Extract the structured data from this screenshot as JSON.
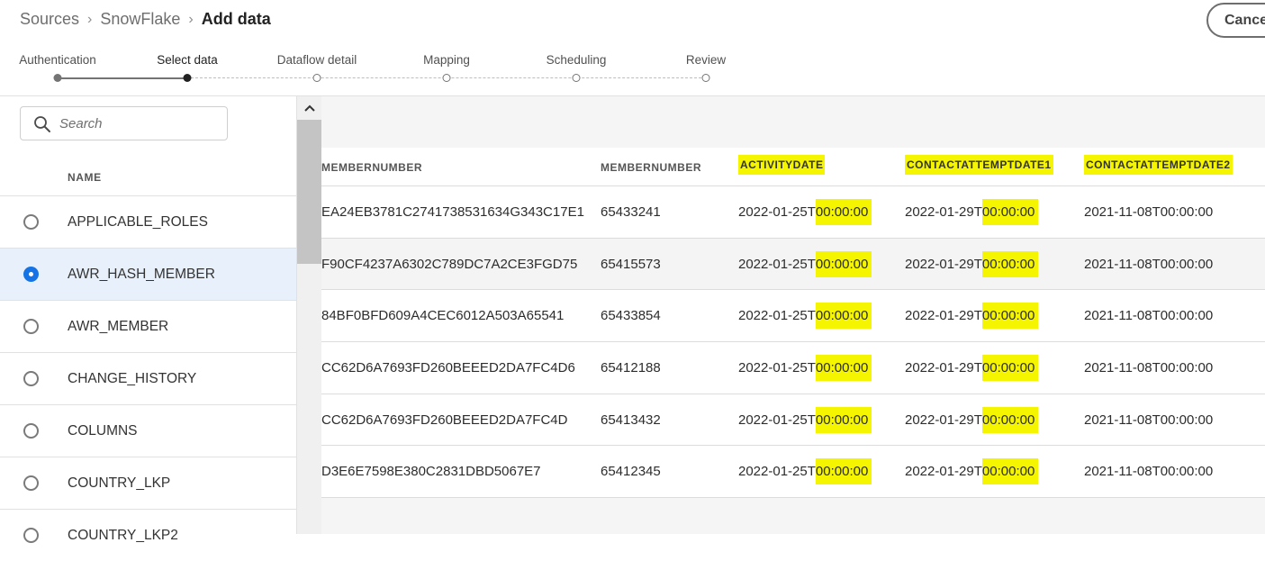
{
  "breadcrumb": {
    "items": [
      "Sources",
      "SnowFlake"
    ],
    "current": "Add data"
  },
  "header": {
    "cancel_label": "Cancel"
  },
  "steps": [
    {
      "label": "Authentication",
      "state": "done"
    },
    {
      "label": "Select data",
      "state": "current"
    },
    {
      "label": "Dataflow detail",
      "state": "todo"
    },
    {
      "label": "Mapping",
      "state": "todo"
    },
    {
      "label": "Scheduling",
      "state": "todo"
    },
    {
      "label": "Review",
      "state": "todo"
    }
  ],
  "search": {
    "placeholder": "Search",
    "value": ""
  },
  "list": {
    "header": "NAME",
    "selected_index": 1,
    "items": [
      "APPLICABLE_ROLES",
      "AWR_HASH_MEMBER",
      "AWR_MEMBER",
      "CHANGE_HISTORY",
      "COLUMNS",
      "COUNTRY_LKP",
      "COUNTRY_LKP2"
    ]
  },
  "table": {
    "columns": [
      "MEMBERNUMBER",
      "MEMBERNUMBER",
      "ACTIVITYDATE",
      "CONTACTATTEMPTDATE1",
      "CONTACTATTEMPTDATE2"
    ],
    "highlighted_columns": [
      "ACTIVITYDATE",
      "CONTACTATTEMPTDATE1",
      "CONTACTATTEMPTDATE2"
    ],
    "rows": [
      {
        "hash": "EA24EB3781C2741738531634G343C17E1",
        "member": "65433241",
        "activity_date": "2022-01-25T",
        "activity_time": "00:00:00",
        "contact1_date": "2022-01-29T",
        "contact1_time": "00:00:00",
        "contact2": "2021-11-08T00:00:00"
      },
      {
        "hash": "F90CF4237A6302C789DC7A2CE3FGD75",
        "member": "65415573",
        "activity_date": "2022-01-25T",
        "activity_time": "00:00:00",
        "contact1_date": "2022-01-29T",
        "contact1_time": "00:00:00",
        "contact2": "2021-11-08T00:00:00"
      },
      {
        "hash": "84BF0BFD609A4CEC6012A503A65541",
        "member": "65433854",
        "activity_date": "2022-01-25T",
        "activity_time": "00:00:00",
        "contact1_date": "2022-01-29T",
        "contact1_time": "00:00:00",
        "contact2": "2021-11-08T00:00:00"
      },
      {
        "hash": "CC62D6A7693FD260BEEED2DA7FC4D6",
        "member": "65412188",
        "activity_date": "2022-01-25T",
        "activity_time": "00:00:00",
        "contact1_date": "2022-01-29T",
        "contact1_time": "00:00:00",
        "contact2": "2021-11-08T00:00:00"
      },
      {
        "hash": "CC62D6A7693FD260BEEED2DA7FC4D",
        "member": "65413432",
        "activity_date": "2022-01-25T",
        "activity_time": "00:00:00",
        "contact1_date": "2022-01-29T",
        "contact1_time": "00:00:00",
        "contact2": "2021-11-08T00:00:00"
      },
      {
        "hash": "D3E6E7598E380C2831DBD5067E7",
        "member": "65412345",
        "activity_date": "2022-01-25T",
        "activity_time": "00:00:00",
        "contact1_date": "2022-01-29T",
        "contact1_time": "00:00:00",
        "contact2": "2021-11-08T00:00:00"
      }
    ]
  },
  "colors": {
    "accent": "#1473e6",
    "highlight": "#f5f500",
    "selected_row": "#e8f1fb"
  },
  "icons": {
    "search": "search-icon",
    "scroll_up": "chevron-up-icon",
    "breadcrumb_sep": "chevron-right-icon"
  }
}
